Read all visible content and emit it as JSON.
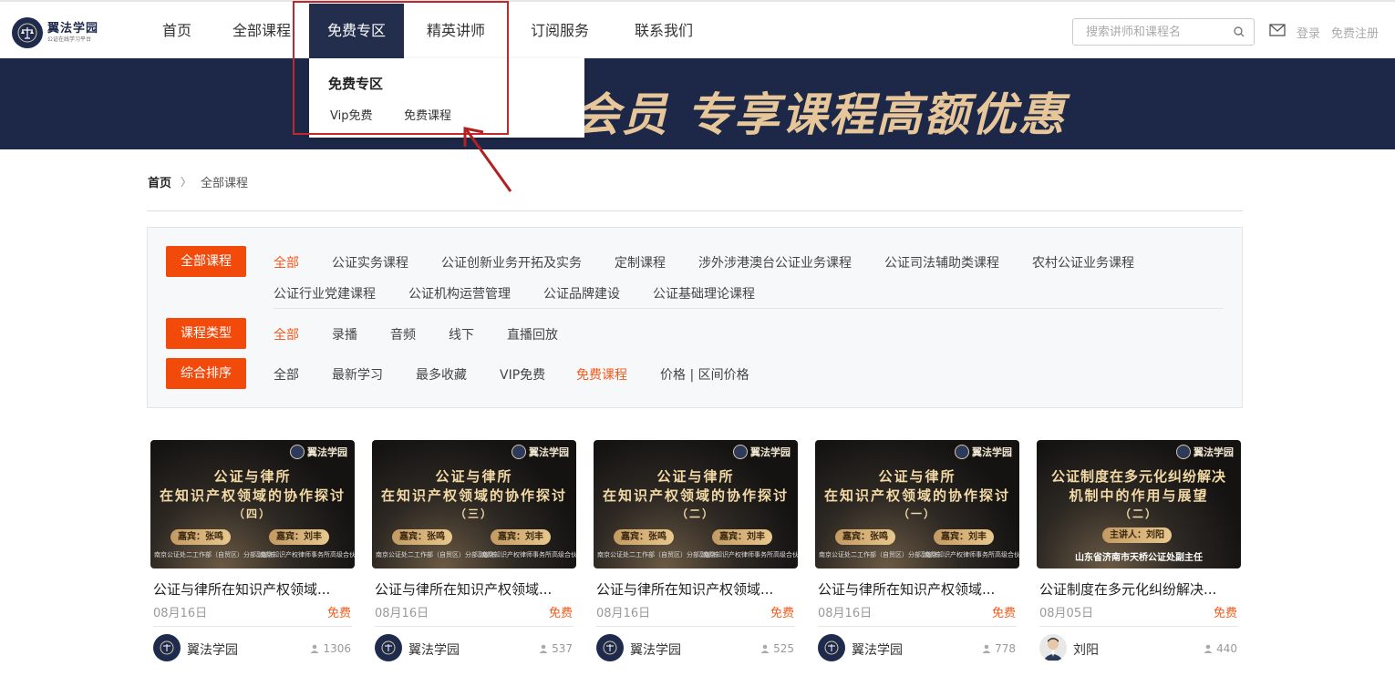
{
  "header": {
    "logo": {
      "title": "翼法学园",
      "subtitle": "公证在线学习平台"
    },
    "nav": [
      "首页",
      "全部课程",
      "免费专区",
      "精英讲师",
      "订阅服务",
      "联系我们"
    ],
    "search_placeholder": "搜索讲师和课程名",
    "login": "登录",
    "register": "免费注册"
  },
  "banner": {
    "text": "P会员  专享课程高额优惠"
  },
  "dropdown": {
    "title": "免费专区",
    "links": [
      "Vip免费",
      "免费课程"
    ]
  },
  "breadcrumb": {
    "home": "首页",
    "current": "全部课程"
  },
  "filters": {
    "category": {
      "label": "全部课程",
      "options": [
        "全部",
        "公证实务课程",
        "公证创新业务开拓及实务",
        "定制课程",
        "涉外涉港澳台公证业务课程",
        "公证司法辅助类课程",
        "农村公证业务课程",
        "公证行业党建课程",
        "公证机构运营管理",
        "公证品牌建设",
        "公证基础理论课程"
      ]
    },
    "type": {
      "label": "课程类型",
      "options": [
        "全部",
        "录播",
        "音频",
        "线下",
        "直播回放"
      ]
    },
    "sort": {
      "label": "综合排序",
      "options": [
        "全部",
        "最新学习",
        "最多收藏",
        "VIP免费",
        "免费课程",
        "价格 | 区间价格"
      ]
    }
  },
  "cards": [
    {
      "thumb_line1": "公证与律所",
      "thumb_line2": "在知识产权领域的协作探讨",
      "thumb_line3": "（四）",
      "guest1": "嘉宾：张鸣",
      "guest2": "嘉宾：刘丰",
      "org1": "南京公证处二工作部（自贸区）分部副部长",
      "org2": "南京知识产权律师事务所高级合伙人副主任",
      "title": "公证与律所在知识产权领域...",
      "date": "08月16日",
      "price": "免费",
      "author": "翼法学园",
      "views": "1306"
    },
    {
      "thumb_line1": "公证与律所",
      "thumb_line2": "在知识产权领域的协作探讨",
      "thumb_line3": "（三）",
      "guest1": "嘉宾：张鸣",
      "guest2": "嘉宾：刘丰",
      "org1": "南京公证处二工作部（自贸区）分部副部长",
      "org2": "南京知识产权律师事务所高级合伙人副主任",
      "title": "公证与律所在知识产权领域...",
      "date": "08月16日",
      "price": "免费",
      "author": "翼法学园",
      "views": "537"
    },
    {
      "thumb_line1": "公证与律所",
      "thumb_line2": "在知识产权领域的协作探讨",
      "thumb_line3": "（二）",
      "guest1": "嘉宾：张鸣",
      "guest2": "嘉宾：刘丰",
      "org1": "南京公证处二工作部（自贸区）分部副部长",
      "org2": "南京知识产权律师事务所高级合伙人副主任",
      "title": "公证与律所在知识产权领域...",
      "date": "08月16日",
      "price": "免费",
      "author": "翼法学园",
      "views": "525"
    },
    {
      "thumb_line1": "公证与律所",
      "thumb_line2": "在知识产权领域的协作探讨",
      "thumb_line3": "（一）",
      "guest1": "嘉宾：张鸣",
      "guest2": "嘉宾：刘丰",
      "org1": "南京公证处二工作部（自贸区）分部副部长",
      "org2": "南京知识产权律师事务所高级合伙人副主任",
      "title": "公证与律所在知识产权领域...",
      "date": "08月16日",
      "price": "免费",
      "author": "翼法学园",
      "views": "778"
    },
    {
      "thumb_line1": "公证制度在多元化纠纷解决",
      "thumb_line2": "机制中的作用与展望",
      "thumb_line3": "（二）",
      "guest1": "主讲人：刘阳",
      "org_single": "山东省济南市天桥公证处副主任",
      "title": "公证制度在多元化纠纷解决...",
      "date": "08月05日",
      "price": "免费",
      "author": "刘阳",
      "views": "440"
    }
  ],
  "colors": {
    "accent": "#f24a0b",
    "nav_active": "#232e4d",
    "banner_bg": "#1d2849",
    "highlight": "#c0282c"
  }
}
